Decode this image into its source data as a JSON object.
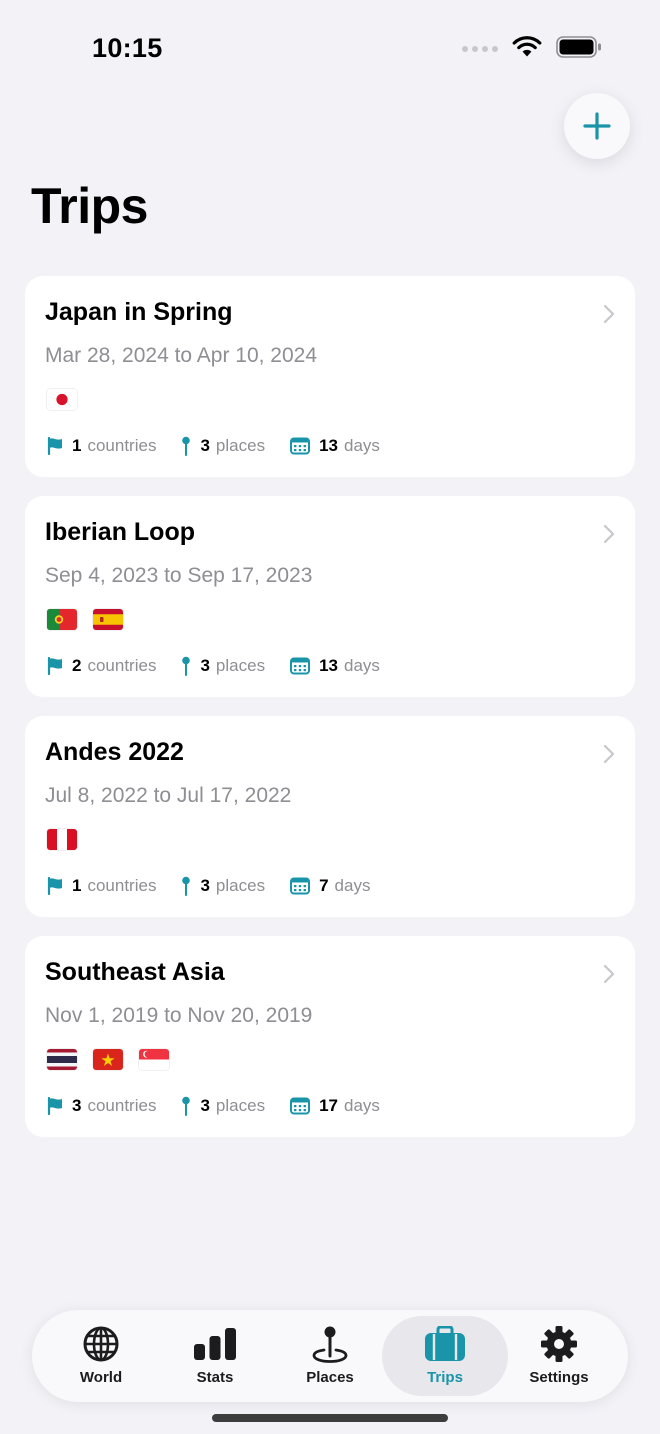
{
  "status_bar": {
    "time": "10:15"
  },
  "header": {
    "title": "Trips",
    "add_icon": "plus-icon"
  },
  "colors": {
    "accent": "#1a94a8",
    "background": "#f2f2f7",
    "card": "#ffffff",
    "secondary_text": "#8e8e93"
  },
  "trips": [
    {
      "name": "Japan in Spring",
      "dates": "Mar 28, 2024 to Apr 10, 2024",
      "flags": [
        "japan-flag"
      ],
      "countries": "1",
      "countries_label": "countries",
      "places": "3",
      "places_label": "places",
      "days": "13",
      "days_label": "days"
    },
    {
      "name": "Iberian Loop",
      "dates": "Sep 4, 2023 to Sep 17, 2023",
      "flags": [
        "portugal-flag",
        "spain-flag"
      ],
      "countries": "2",
      "countries_label": "countries",
      "places": "3",
      "places_label": "places",
      "days": "13",
      "days_label": "days"
    },
    {
      "name": "Andes 2022",
      "dates": "Jul 8, 2022 to Jul 17, 2022",
      "flags": [
        "peru-flag"
      ],
      "countries": "1",
      "countries_label": "countries",
      "places": "3",
      "places_label": "places",
      "days": "7",
      "days_label": "days"
    },
    {
      "name": "Southeast Asia",
      "dates": "Nov 1, 2019 to Nov 20, 2019",
      "flags": [
        "thailand-flag",
        "vietnam-flag",
        "singapore-flag"
      ],
      "countries": "3",
      "countries_label": "countries",
      "places": "3",
      "places_label": "places",
      "days": "17",
      "days_label": "days"
    }
  ],
  "tab_bar": {
    "items": [
      {
        "label": "World",
        "icon": "globe-icon",
        "active": false
      },
      {
        "label": "Stats",
        "icon": "bar-chart-icon",
        "active": false
      },
      {
        "label": "Places",
        "icon": "map-pin-icon",
        "active": false
      },
      {
        "label": "Trips",
        "icon": "suitcase-icon",
        "active": true
      },
      {
        "label": "Settings",
        "icon": "gear-icon",
        "active": false
      }
    ]
  }
}
